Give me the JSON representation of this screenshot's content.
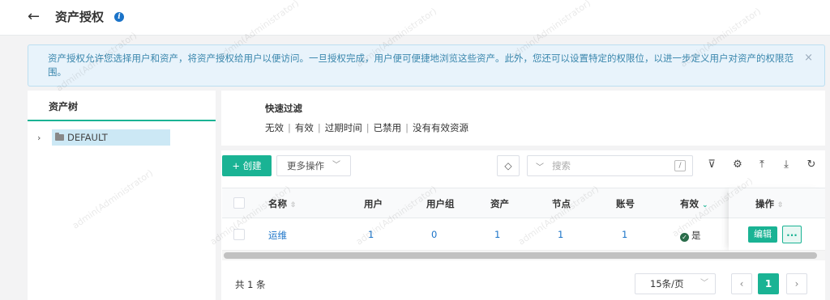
{
  "header": {
    "title": "资产授权",
    "back_icon": "arrow-left-icon",
    "info_icon": "info-icon"
  },
  "alert": {
    "text": "资产授权允许您选择用户和资产，将资产授权给用户以便访问。一旦授权完成，用户便可便捷地浏览这些资产。此外，您还可以设置特定的权限位，以进一步定义用户对资产的权限范围。",
    "close_icon": "close-icon"
  },
  "tree": {
    "title": "资产树",
    "nodes": [
      {
        "label": "DEFAULT",
        "icon": "folder-icon"
      }
    ]
  },
  "filter": {
    "title": "快速过滤",
    "links": [
      "无效",
      "有效",
      "过期时间",
      "已禁用",
      "没有有效资源"
    ]
  },
  "toolbar": {
    "create_label": "+ 创建",
    "more_label": "更多操作",
    "search_placeholder": "搜索",
    "search_shortcut": "/"
  },
  "table": {
    "columns": {
      "name": "名称",
      "users": "用户",
      "user_groups": "用户组",
      "assets": "资产",
      "nodes": "节点",
      "accounts": "账号",
      "active": "有效",
      "actions": "操作"
    },
    "rows": [
      {
        "name": "运维",
        "users": "1",
        "user_groups": "0",
        "assets": "1",
        "nodes": "1",
        "accounts": "1",
        "active": "是",
        "edit_label": "编辑",
        "more_label": "..."
      }
    ]
  },
  "pagination": {
    "total": "共 1 条",
    "page_size": "15条/页",
    "prev": "‹",
    "next": "›",
    "current_page": "1"
  },
  "watermark": "admin(Administrator)",
  "colors": {
    "primary": "#1ab394",
    "link": "#1a73c8",
    "alert_bg": "#e8f3fb"
  }
}
